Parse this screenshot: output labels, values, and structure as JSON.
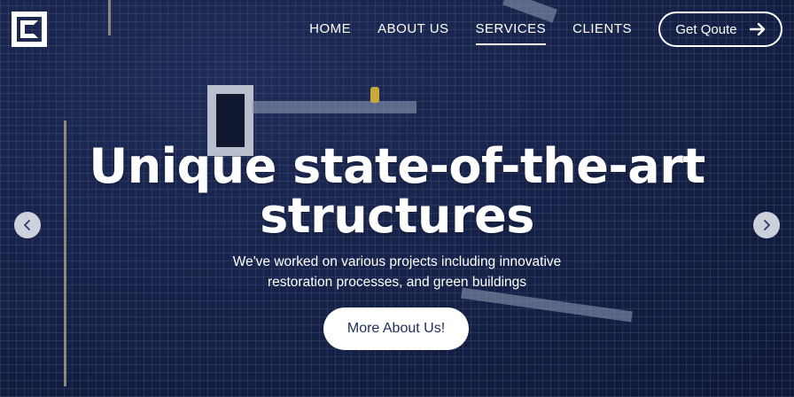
{
  "brand": {
    "logo_icon": "square-logo-icon"
  },
  "nav": {
    "items": [
      {
        "label": "HOME",
        "active": false
      },
      {
        "label": "ABOUT US",
        "active": false
      },
      {
        "label": "SERVICES",
        "active": true
      },
      {
        "label": "CLIENTS",
        "active": false
      }
    ],
    "cta": {
      "label": "Get Qoute",
      "icon": "arrow-right-icon"
    }
  },
  "hero": {
    "headline_line1": "Unique state-of-the-art",
    "headline_line2": "structures",
    "subtext_line1": "We've worked on various projects including innovative",
    "subtext_line2": "restoration processes, and green buildings",
    "button_label": "More About Us!",
    "prev_icon": "chevron-left-icon",
    "next_icon": "chevron-right-icon"
  },
  "colors": {
    "background": "#1c2a57",
    "text": "#ffffff",
    "button_text": "#1f2d5c"
  }
}
